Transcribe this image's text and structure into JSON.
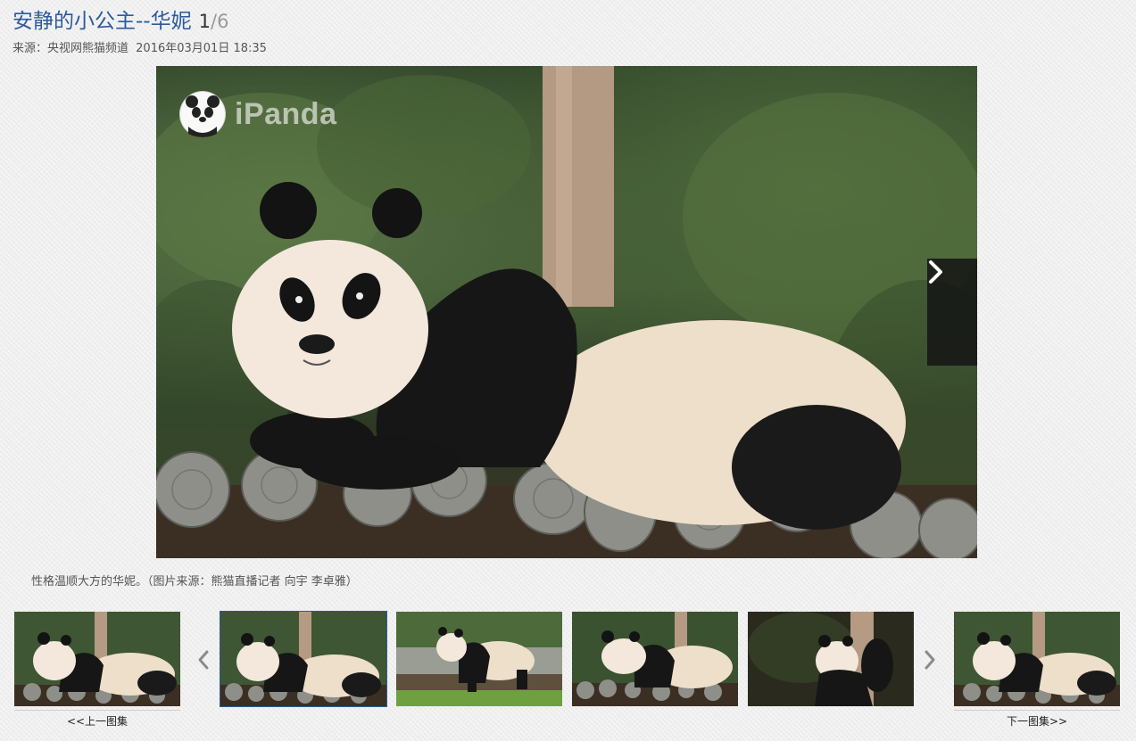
{
  "header": {
    "title": "安静的小公主--华妮",
    "current_index": "1",
    "separator": "/",
    "total": "6"
  },
  "meta": {
    "source_label": "来源：央视网熊猫频道",
    "datetime": "2016年03月01日 18:35"
  },
  "photo": {
    "watermark_text": "iPanda",
    "next_icon": "chevron-right-icon"
  },
  "caption": "性格温顺大方的华妮。（图片来源：熊猫直播记者 向宇 李卓雅）",
  "strip": {
    "prev_gallery_label": "<<上一图集",
    "next_gallery_label": "下一图集>>",
    "prev_icon": "chevron-left-icon",
    "next_icon": "chevron-right-icon",
    "thumbnail_count": 6,
    "active_thumbnail": 1
  },
  "colors": {
    "title": "#2b5a9e",
    "active_border": "#2b5a9e",
    "arrow_bg": "#141414"
  }
}
